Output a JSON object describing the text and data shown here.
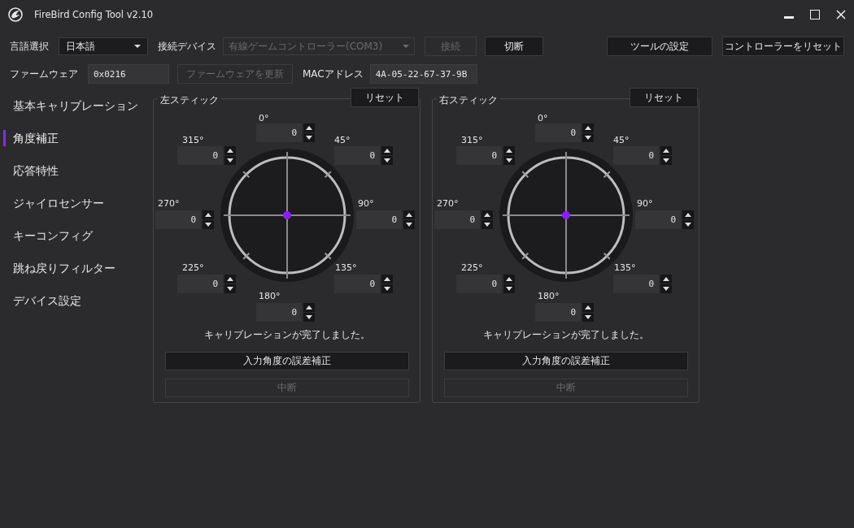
{
  "window": {
    "title": "FireBird Config Tool v2.10"
  },
  "toolbar": {
    "language_label": "言語選択",
    "language": "日本語",
    "device_label": "接続デバイス",
    "device": {
      "value": "有線ゲームコントローラー(COM3)",
      "disabled": true
    },
    "connect": {
      "label": "接続",
      "disabled": true
    },
    "disconnect": {
      "label": "切断",
      "disabled": false
    },
    "tool_settings": "ツールの設定",
    "reset_controller": "コントローラーをリセット"
  },
  "firmware": {
    "label": "ファームウェア",
    "value": "0x0216",
    "update": {
      "label": "ファームウェアを更新",
      "disabled": true
    },
    "mac_label": "MACアドレス",
    "mac": "4A-05-22-67-37-9B"
  },
  "sidebar": {
    "items": [
      {
        "label": "基本キャリブレーション",
        "selected": false
      },
      {
        "label": "角度補正",
        "selected": true
      },
      {
        "label": "応答特性",
        "selected": false
      },
      {
        "label": "ジャイロセンサー",
        "selected": false
      },
      {
        "label": "キーコンフィグ",
        "selected": false
      },
      {
        "label": "跳ね戻りフィルター",
        "selected": false
      },
      {
        "label": "デバイス設定",
        "selected": false
      }
    ]
  },
  "sticks": [
    {
      "title": "左スティック",
      "reset": "リセット",
      "angles": [
        {
          "label": "0°",
          "value": "0"
        },
        {
          "label": "45°",
          "value": "0"
        },
        {
          "label": "90°",
          "value": "0"
        },
        {
          "label": "135°",
          "value": "0"
        },
        {
          "label": "180°",
          "value": "0"
        },
        {
          "label": "225°",
          "value": "0"
        },
        {
          "label": "270°",
          "value": "0"
        },
        {
          "label": "315°",
          "value": "0"
        }
      ],
      "status": "キャリブレーションが完了しました。",
      "correct_button": {
        "label": "入力角度の誤差補正",
        "disabled": false
      },
      "stop_button": {
        "label": "中断",
        "disabled": true
      }
    },
    {
      "title": "右スティック",
      "reset": "リセット",
      "angles": [
        {
          "label": "0°",
          "value": "0"
        },
        {
          "label": "45°",
          "value": "0"
        },
        {
          "label": "90°",
          "value": "0"
        },
        {
          "label": "135°",
          "value": "0"
        },
        {
          "label": "180°",
          "value": "0"
        },
        {
          "label": "225°",
          "value": "0"
        },
        {
          "label": "270°",
          "value": "0"
        },
        {
          "label": "315°",
          "value": "0"
        }
      ],
      "status": "キャリブレーションが完了しました。",
      "correct_button": {
        "label": "入力角度の誤差補正",
        "disabled": false
      },
      "stop_button": {
        "label": "中断",
        "disabled": true
      }
    }
  ]
}
